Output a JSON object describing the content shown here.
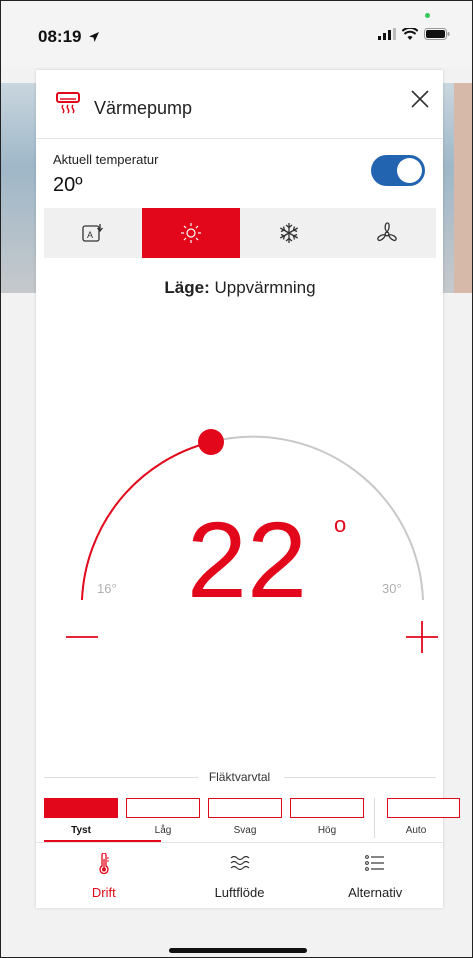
{
  "status_bar": {
    "time": "08:19"
  },
  "header": {
    "title": "Värmepump",
    "app_icon": "air-conditioner-icon",
    "close_icon": "close-icon"
  },
  "current_temp": {
    "label": "Aktuell temperatur",
    "value": "20º",
    "power_on": true
  },
  "modes": [
    {
      "name": "auto",
      "icon": "auto-mode-icon",
      "active": false
    },
    {
      "name": "heat",
      "icon": "sun-icon",
      "active": true
    },
    {
      "name": "cool",
      "icon": "snowflake-icon",
      "active": false
    },
    {
      "name": "fan",
      "icon": "fan-icon",
      "active": false
    }
  ],
  "mode_line": {
    "prefix": "Läge:",
    "value": "Uppvärmning"
  },
  "thermostat": {
    "setpoint": "22",
    "degree": "o",
    "min_label": "16°",
    "max_label": "30°",
    "setpoint_value": 22,
    "min": 16,
    "max": 30
  },
  "fan_speed": {
    "title": "Fläktvarvtal",
    "options": [
      "Tyst",
      "Låg",
      "Svag",
      "Hög",
      "Auto"
    ],
    "selected": "Tyst"
  },
  "tabs": [
    {
      "label": "Drift",
      "icon": "thermometer-icon",
      "active": true
    },
    {
      "label": "Luftflöde",
      "icon": "airflow-icon",
      "active": false
    },
    {
      "label": "Alternativ",
      "icon": "list-icon",
      "active": false
    }
  ],
  "colors": {
    "accent": "#e2071a",
    "toggle": "#2264b0",
    "arc_inactive": "#c8c8c8"
  }
}
